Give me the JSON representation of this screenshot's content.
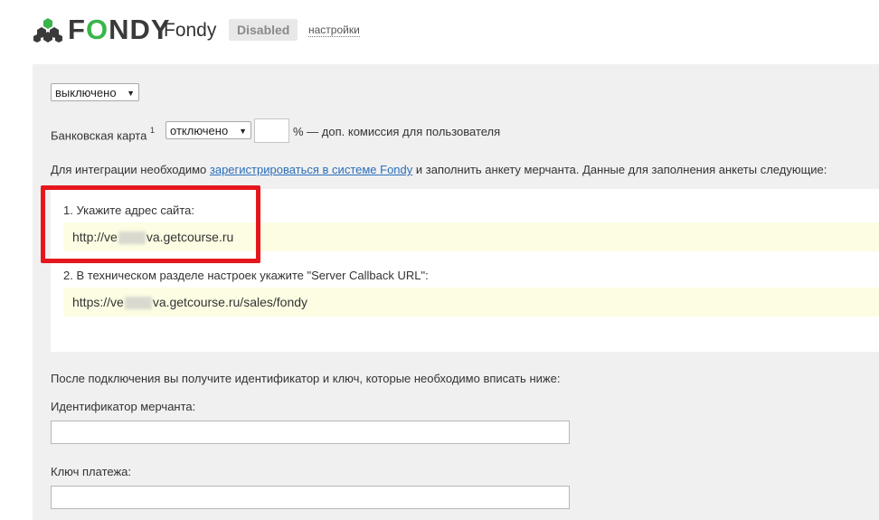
{
  "header": {
    "brand_prefix": "F",
    "brand_o": "O",
    "brand_suffix": "NDY",
    "title": "Fondy",
    "status_badge": "Disabled",
    "settings_link": "настройки"
  },
  "form": {
    "status_select": "выключено",
    "card_label": "Банковская карта",
    "card_footnote": "1",
    "card_select": "отключено",
    "commission_value": "",
    "commission_text": "% — доп. комиссия для пользователя",
    "intro_before": "Для интеграции необходимо ",
    "intro_link": "зарегистрироваться в системе Fondy",
    "intro_after": " и заполнить анкету мерчанта. Данные для заполнения анкеты следующие:",
    "step1_label": "1. Укажите адрес сайта:",
    "step1_prefix": "http://ve",
    "step1_suffix": "va.getcourse.ru",
    "step2_label": "2. В техническом разделе настроек укажите \"Server Callback URL\":",
    "step2_prefix": "https://ve",
    "step2_suffix": "va.getcourse.ru/sales/fondy",
    "after_text": "После подключения вы получите идентификатор и ключ, которые необходимо вписать ниже:",
    "merchant_id_label": "Идентификатор мерчанта:",
    "merchant_id_value": "",
    "payment_key_label": "Ключ платежа:",
    "payment_key_value": ""
  },
  "colors": {
    "brand_green": "#39b54a",
    "highlight_red": "#e5171c",
    "link_blue": "#2a6ebb",
    "value_bg": "#fdfde3",
    "panel_bg": "#f0f0f0"
  },
  "icons": {
    "logo": "hexagon-cluster-icon",
    "dropdown": "triangle-down-icon"
  }
}
